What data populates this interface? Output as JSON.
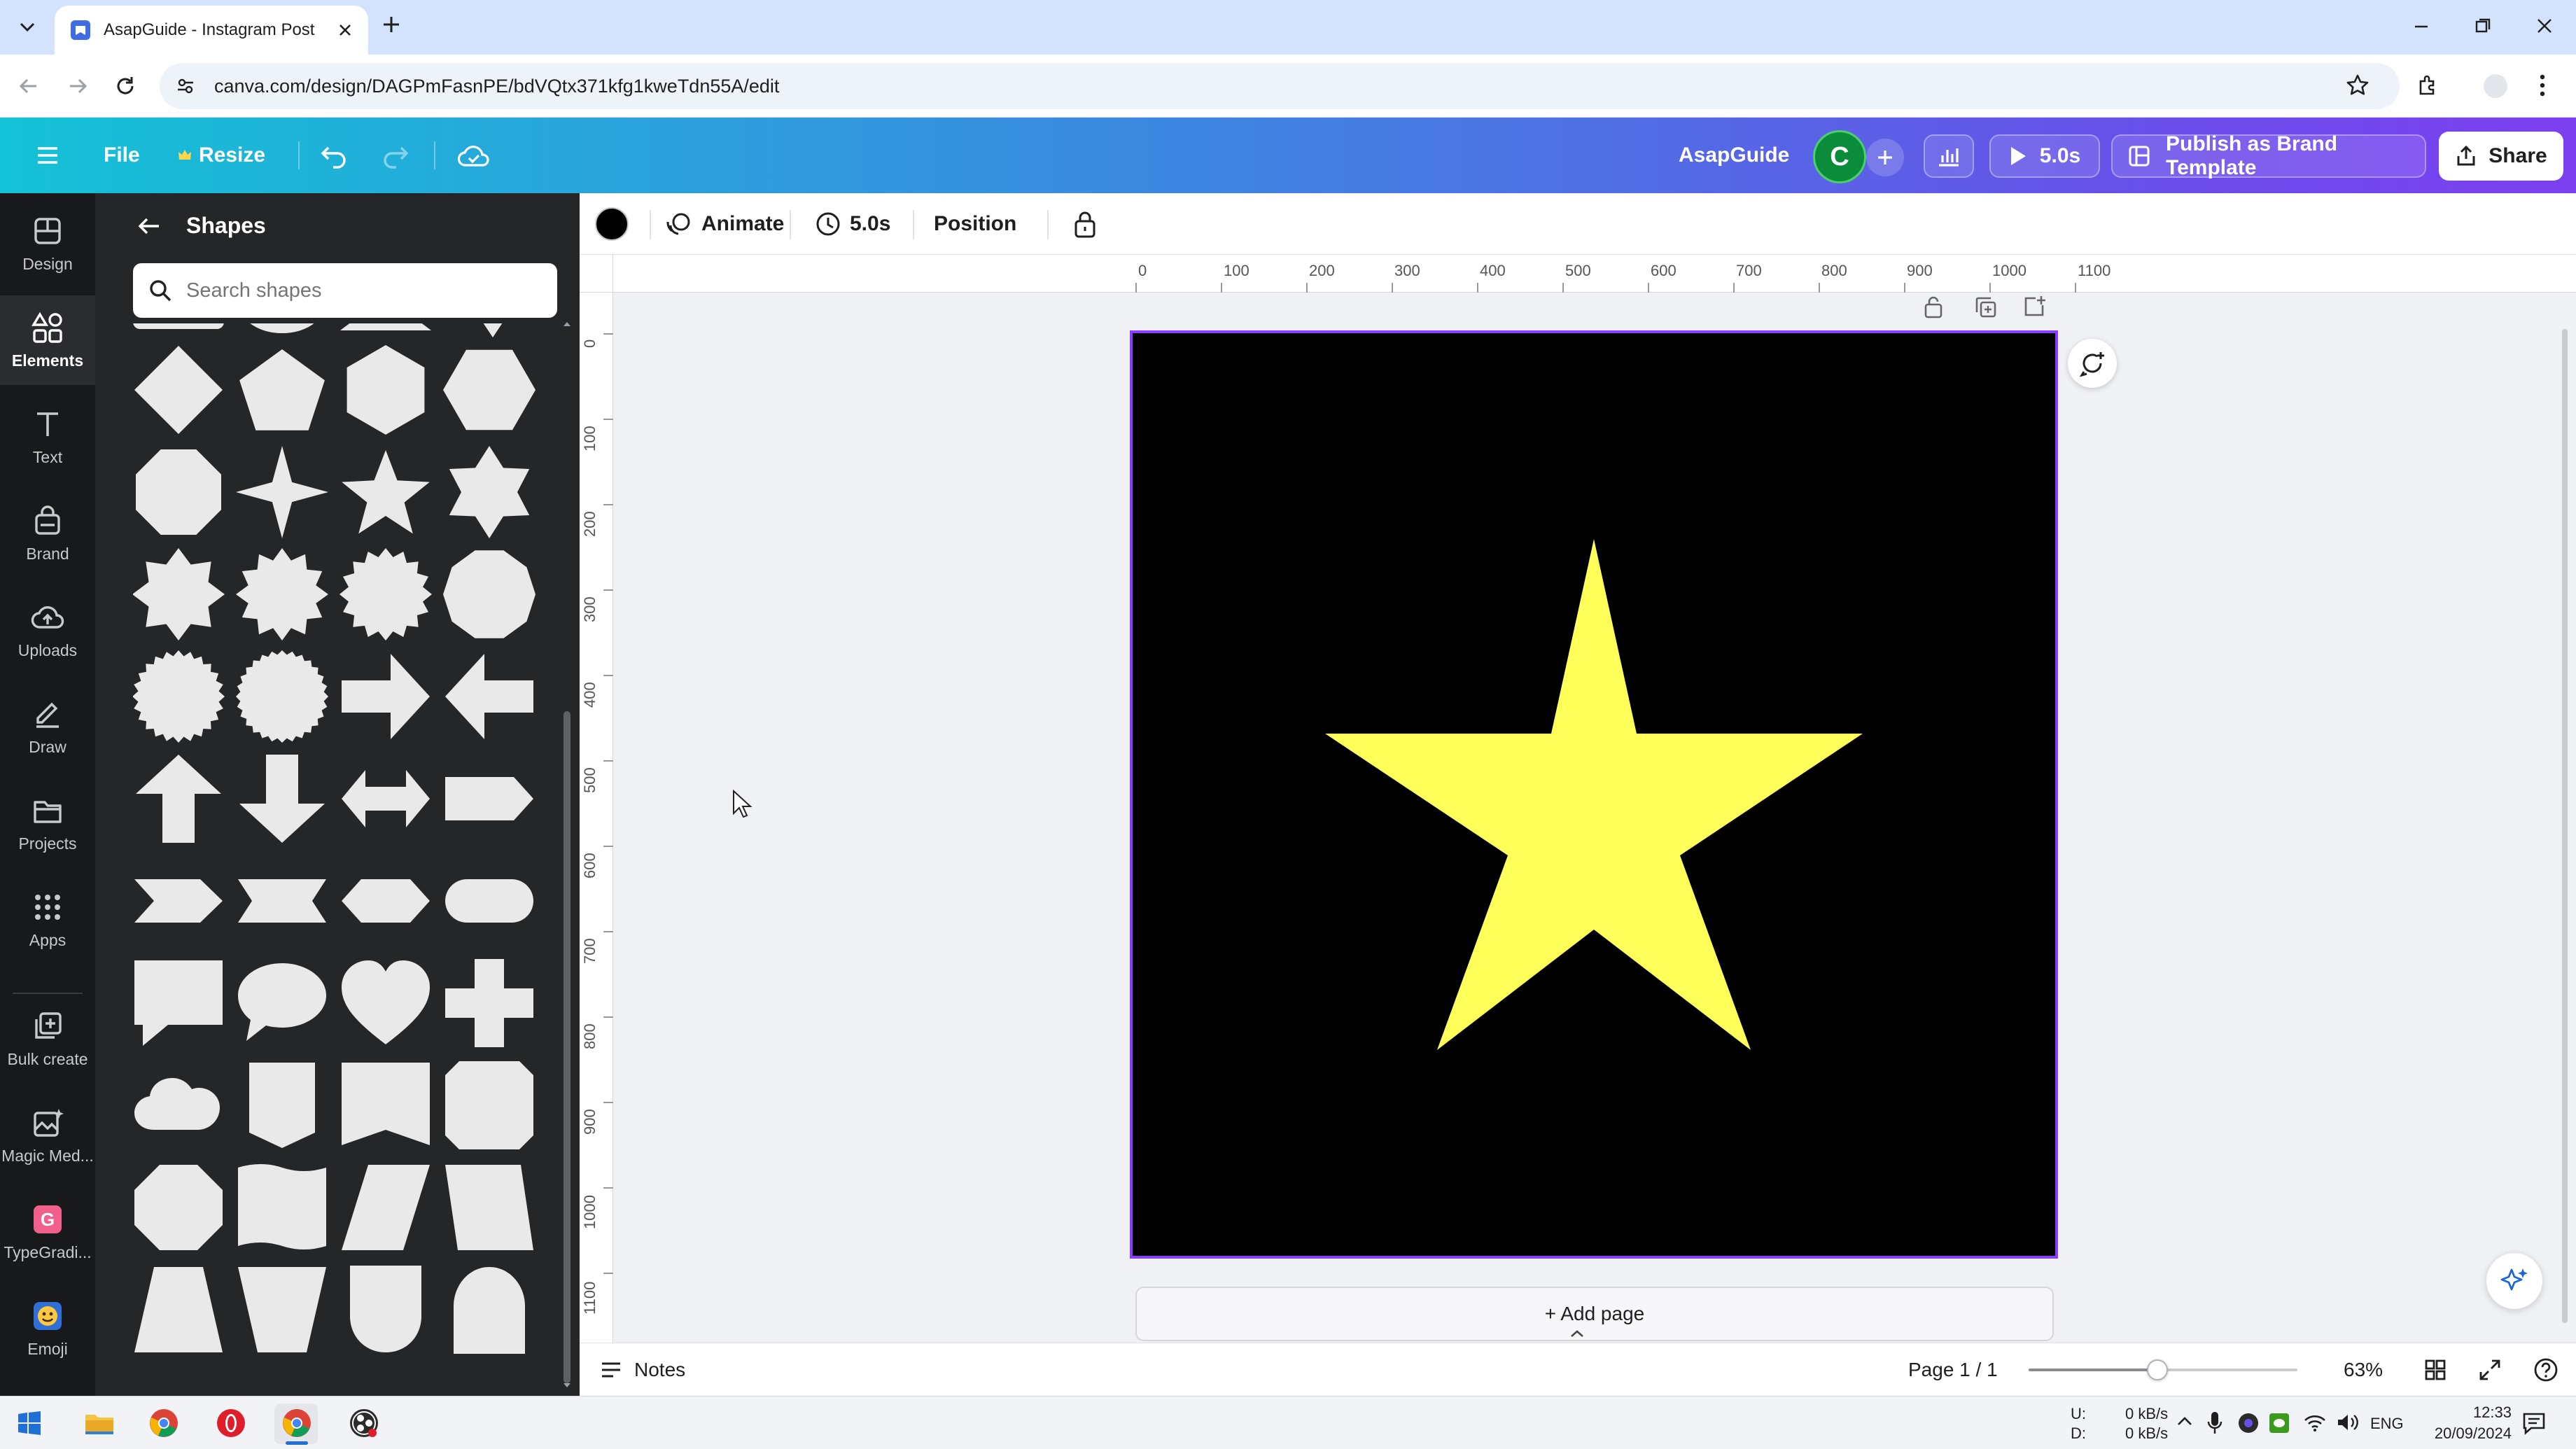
{
  "browser": {
    "tab_title": "AsapGuide - Instagram Post",
    "url": "canva.com/design/DAGPmFasnPE/bdVQtx371kfg1kweTdn55A/edit",
    "icons": [
      "tab-menu-icon",
      "canva-favicon-icon",
      "close-icon",
      "new-tab-icon",
      "back-icon",
      "forward-icon",
      "reload-icon",
      "site-info-icon",
      "bookmark-star-icon",
      "extensions-icon",
      "profile-icon",
      "more-icon",
      "minimize-icon",
      "restore-icon",
      "window-close-icon"
    ]
  },
  "header": {
    "file_label": "File",
    "resize_label": "Resize",
    "brand_name": "AsapGuide",
    "avatar_letter": "C",
    "play_label": "5.0s",
    "publish_label": "Publish as Brand Template",
    "share_label": "Share"
  },
  "rail": {
    "items": [
      {
        "label": "Design",
        "icon": "design-icon"
      },
      {
        "label": "Elements",
        "icon": "elements-icon",
        "active": true
      },
      {
        "label": "Text",
        "icon": "text-icon"
      },
      {
        "label": "Brand",
        "icon": "brand-icon"
      },
      {
        "label": "Uploads",
        "icon": "uploads-icon"
      },
      {
        "label": "Draw",
        "icon": "draw-icon"
      },
      {
        "label": "Projects",
        "icon": "projects-icon"
      },
      {
        "label": "Apps",
        "icon": "apps-icon"
      },
      {
        "label": "Bulk create",
        "icon": "bulk-create-icon"
      },
      {
        "label": "Magic Med...",
        "icon": "magic-media-icon"
      },
      {
        "label": "TypeGradi...",
        "icon": "typegradient-icon"
      },
      {
        "label": "Emoji",
        "icon": "emoji-icon"
      }
    ]
  },
  "panel": {
    "title": "Shapes",
    "search_placeholder": "Search shapes",
    "shape_names": [
      "diamond",
      "pentagon",
      "hexagon-flat",
      "hexagon-pointy",
      "octagon",
      "star-4",
      "star-5",
      "star-6",
      "burst-8",
      "burst-12",
      "burst-16",
      "burst-10",
      "seal-24",
      "seal-28",
      "arrow-right",
      "arrow-left",
      "arrow-up",
      "arrow-down",
      "arrow-double",
      "tag-right",
      "chevron",
      "ribbon",
      "hexagon-wide",
      "pill",
      "speech-bubble-rect",
      "speech-bubble-round",
      "heart",
      "cross",
      "cloud",
      "shield-pentagon",
      "banner-notch",
      "rounded-square",
      "octagon-rounded",
      "wavy-rect",
      "parallelogram",
      "trapezoid-down",
      "trapezoid-up",
      "trapezoid-inverted",
      "shield-u",
      "arch"
    ]
  },
  "toolbar": {
    "fill_color": "#000000",
    "animate_label": "Animate",
    "duration_label": "5.0s",
    "position_label": "Position"
  },
  "ruler": {
    "h_ticks": [
      "0",
      "100",
      "200",
      "300",
      "400",
      "500",
      "600",
      "700",
      "800",
      "900",
      "1000",
      "1100"
    ],
    "v_ticks": [
      "0",
      "100",
      "200",
      "300",
      "400",
      "500",
      "600",
      "700",
      "800",
      "900",
      "1000",
      "1100"
    ]
  },
  "canvas": {
    "background": "#000000",
    "star_color": "#ffff5a",
    "add_page_label": "+ Add page"
  },
  "footer": {
    "notes_label": "Notes",
    "page_indicator": "Page 1 / 1",
    "zoom_percent": 63,
    "zoom_label": "63%"
  },
  "taskbar": {
    "apps": [
      "windows-start-icon",
      "file-explorer-icon",
      "chrome-icon",
      "opera-icon",
      "chrome-icon-2",
      "obs-icon"
    ],
    "net_up_label": "U:",
    "net_down_label": "D:",
    "net_up_value": "0 kB/s",
    "net_down_value": "0 kB/s",
    "language": "ENG",
    "time": "12:33",
    "date": "20/09/2024"
  },
  "colors": {
    "accent": "#8b3dff",
    "rail_bg": "#18191b",
    "panel_bg": "#252627",
    "shape_fill": "#e9e9ea"
  }
}
